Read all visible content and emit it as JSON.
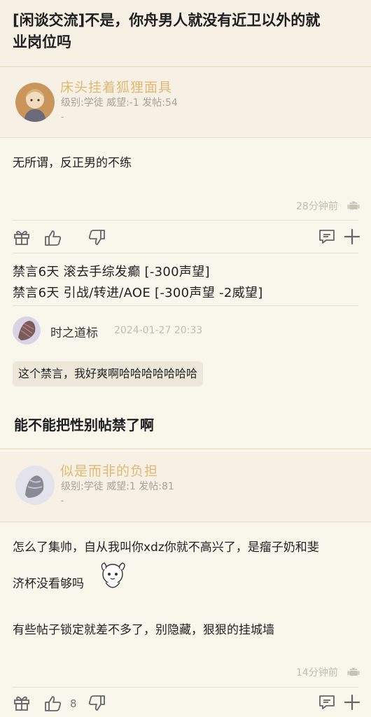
{
  "thread": {
    "title_line1": "[闲谈交流]不是，你舟男人就没有近卫以外的就",
    "title_line2": "业岗位吗"
  },
  "post1": {
    "username": "床头挂着狐狸面具",
    "userinfo": "级别:学徒 威望:-1 发帖:54",
    "dash": "-",
    "content": "无所谓，反正男的不练",
    "time": "28分钟前",
    "mod_lines": [
      "禁言6天 滚去手综发癫 [-300声望]",
      "禁言6天 引战/转进/AOE [-300声望 -2威望]"
    ],
    "comment": {
      "author": "时之道标",
      "time": "2024-01-27 20:33",
      "text": "这个禁言，我好爽啊哈哈哈哈哈哈哈"
    }
  },
  "section": {
    "title": "能不能把性别帖禁了啊"
  },
  "post2": {
    "username": "似是而非的负担",
    "userinfo": "级别:学徒 威望:1 发帖:81",
    "dash": "-",
    "content_line1": "怎么了集帅，自从我叫你xdz你就不高兴了，是瘤子奶和斐",
    "content_line2": "济杯没看够吗",
    "content_line3": "有些帖子锁定就差不多了，别隐藏，狠狠的挂城墙",
    "time": "14分钟前",
    "like_count": "8"
  },
  "icons": {
    "gift": "gift-icon",
    "like": "thumbs-up-icon",
    "dislike": "thumbs-down-icon",
    "comment": "comment-icon",
    "add": "plus-icon",
    "android": "android-icon"
  },
  "colors": {
    "username": "#e1b873",
    "background": "#f9f6ec",
    "header": "#f6f1e4"
  }
}
